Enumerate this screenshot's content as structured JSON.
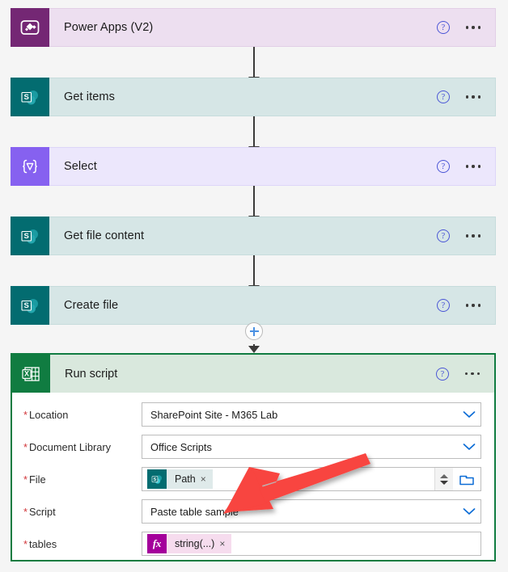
{
  "flow": {
    "steps": [
      {
        "id": "power-apps-v2",
        "title": "Power Apps (V2)",
        "icon": "powerapps-icon",
        "theme": "powerapps",
        "help_label": "?",
        "menu_label": "More commands"
      },
      {
        "id": "get-items",
        "title": "Get items",
        "icon": "sharepoint-icon",
        "theme": "sharepoint",
        "help_label": "?",
        "menu_label": "More commands"
      },
      {
        "id": "select",
        "title": "Select",
        "icon": "select-icon",
        "theme": "select",
        "help_label": "?",
        "menu_label": "More commands"
      },
      {
        "id": "get-file-content",
        "title": "Get file content",
        "icon": "sharepoint-icon",
        "theme": "sharepoint",
        "help_label": "?",
        "menu_label": "More commands"
      },
      {
        "id": "create-file",
        "title": "Create file",
        "icon": "sharepoint-icon",
        "theme": "sharepoint",
        "help_label": "?",
        "menu_label": "More commands"
      }
    ],
    "insert_button": {
      "name": "add-step-button",
      "glyph": "+"
    }
  },
  "run_script": {
    "title": "Run script",
    "icon": "excel-icon",
    "help_label": "?",
    "menu_label": "More commands",
    "border_color": "#107c41",
    "header_color": "#d9e8dd",
    "fields": [
      {
        "id": "location",
        "label": "Location",
        "required": true,
        "value": "SharePoint Site - M365 Lab",
        "control": "dropdown"
      },
      {
        "id": "document-library",
        "label": "Document Library",
        "required": true,
        "value": "Office Scripts",
        "control": "dropdown"
      },
      {
        "id": "file",
        "label": "File",
        "required": true,
        "control": "token-picker",
        "token": {
          "label": "Path",
          "icon": "sharepoint-icon",
          "remove_glyph": "×"
        }
      },
      {
        "id": "script",
        "label": "Script",
        "required": true,
        "value": "Paste table sample",
        "control": "dropdown"
      },
      {
        "id": "tables",
        "label": "tables",
        "required": true,
        "control": "token",
        "token": {
          "label": "string(...)",
          "icon": "fx-icon",
          "fx_glyph": "fx",
          "remove_glyph": "×"
        }
      }
    ]
  },
  "annotation": {
    "arrow_color": "#f8443f",
    "points_to": "script"
  },
  "colors": {
    "powerapps_icon": "#742774",
    "sharepoint_icon": "#036c70",
    "select_icon": "#8661f0",
    "excel_icon": "#107c41",
    "fx_icon": "#a4009b",
    "help_blue": "#4b56d6",
    "accent_blue": "#0b6cd6",
    "required_red": "#d13438"
  }
}
